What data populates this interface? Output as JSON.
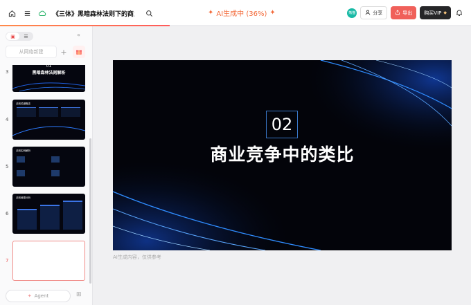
{
  "header": {
    "title": "《三体》黑暗森林法则下的商业...",
    "gen_status": "AI生成中 (36%)",
    "gen_progress_pct": 36,
    "avatar_text": "熊猫",
    "share_label": "分享",
    "export_label": "导出",
    "vip_label": "购买VIP"
  },
  "sidebar": {
    "outline_placeholder": "从网络新建",
    "agent_label": "Agent",
    "slides": [
      {
        "num": "3",
        "line1": "01",
        "line2": "黑暗森林法则解析"
      },
      {
        "num": "4",
        "label": "法则关键概念"
      },
      {
        "num": "5",
        "label": "法则实例解析"
      },
      {
        "num": "6",
        "label": "法则局限分析"
      },
      {
        "num": "7"
      }
    ]
  },
  "slide": {
    "number": "02",
    "title": "商业竞争中的类比"
  },
  "disclaimer": "AI生成内容，仅供参考",
  "colors": {
    "accent": "#f36a3a",
    "export": "#f0605a",
    "vip": "#262628",
    "frame": "#3a78c9"
  }
}
